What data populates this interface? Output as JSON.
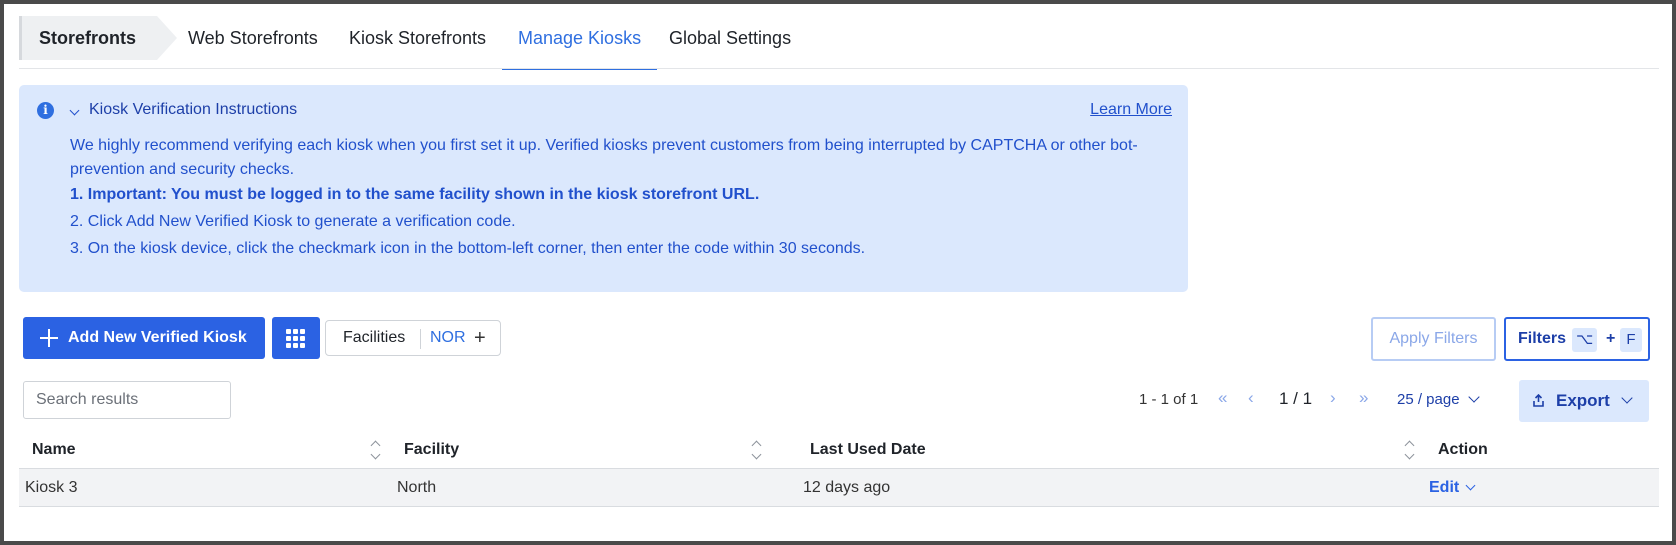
{
  "tabs": {
    "breadcrumb": "Storefronts",
    "items": [
      {
        "label": "Web Storefronts"
      },
      {
        "label": "Kiosk Storefronts"
      },
      {
        "label": "Manage Kiosks"
      },
      {
        "label": "Global Settings"
      }
    ],
    "active": "Manage Kiosks"
  },
  "info": {
    "title": "Kiosk Verification Instructions",
    "learn_more": "Learn More",
    "paragraph": "We highly recommend verifying each kiosk when you first set it up. Verified kiosks prevent customers from being interrupted by CAPTCHA or other bot-prevention and security checks.",
    "steps": [
      "1. Important: You must be logged in to the same facility shown in the kiosk storefront URL.",
      "2. Click Add New Verified Kiosk to generate a verification code.",
      "3. On the kiosk device, click the checkmark icon in the bottom-left corner, then enter the code within 30 seconds."
    ]
  },
  "toolbar": {
    "add_label": "Add New Verified Kiosk",
    "facilities_label": "Facilities",
    "facilities_value": "NOR",
    "apply_filters": "Apply Filters",
    "filters_label": "Filters",
    "shortcut_key1": "⌥",
    "shortcut_plus": "+",
    "shortcut_key2": "F"
  },
  "search": {
    "placeholder": "Search results",
    "value": ""
  },
  "pagination": {
    "range": "1 - 1 of 1",
    "page": "1 / 1",
    "per_page": "25 / page",
    "export": "Export"
  },
  "table": {
    "columns": [
      "Name",
      "Facility",
      "Last Used Date",
      "Action"
    ],
    "rows": [
      {
        "name": "Kiosk 3",
        "facility": "North",
        "last_used": "12 days ago",
        "action": "Edit"
      }
    ]
  },
  "colors": {
    "accent": "#2b62e3",
    "info_bg": "#dbe8fd",
    "info_text": "#2150cc"
  }
}
